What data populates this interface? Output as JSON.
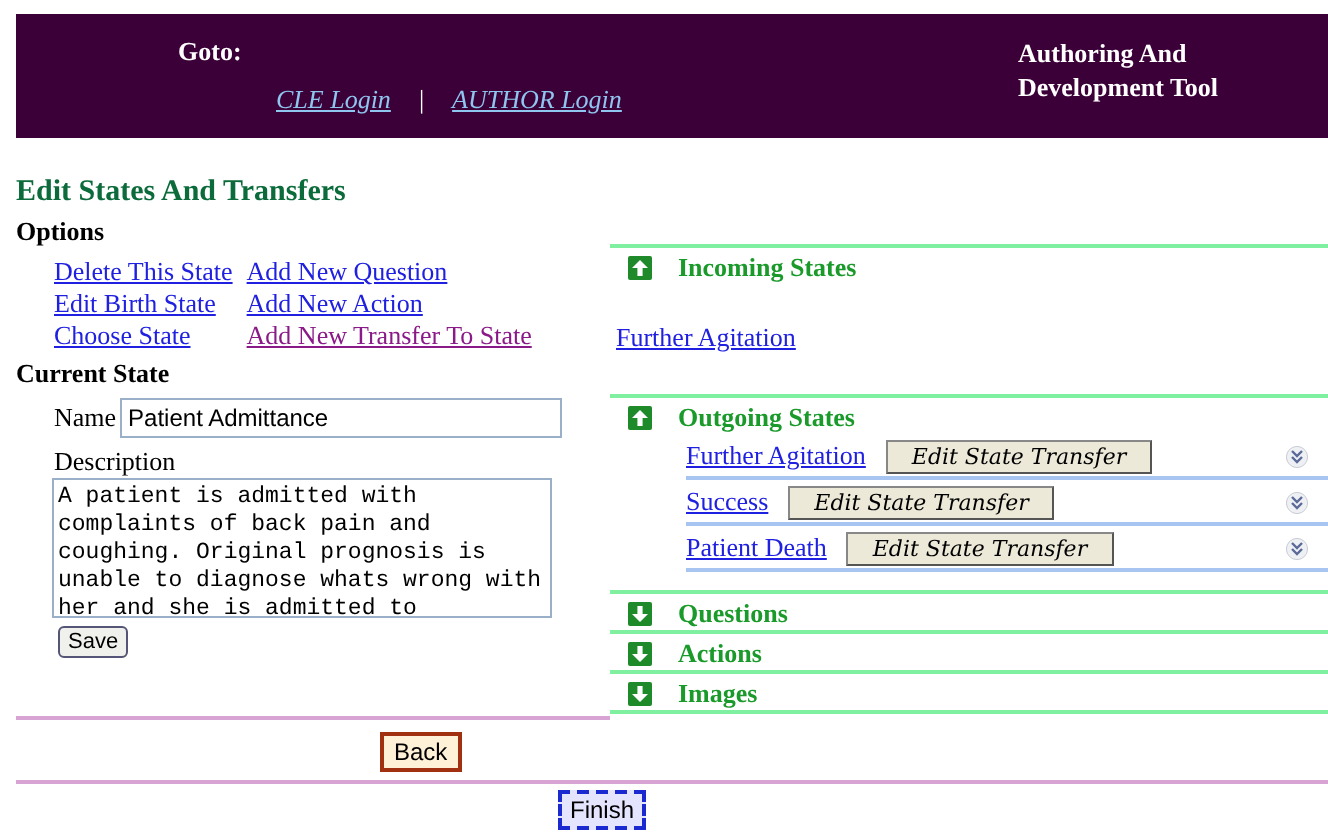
{
  "header": {
    "goto_label": "Goto:",
    "links": [
      "CLE Login",
      "AUTHOR Login"
    ],
    "separator": "|",
    "tool_title": "Authoring And Development Tool"
  },
  "page_title": "Edit States And Transfers",
  "options": {
    "heading": "Options",
    "links": [
      {
        "label": "Delete This State",
        "visited": false
      },
      {
        "label": "Add New Question",
        "visited": false
      },
      {
        "label": "Edit Birth State",
        "visited": false
      },
      {
        "label": "Add New Action",
        "visited": false
      },
      {
        "label": "Choose State",
        "visited": false
      },
      {
        "label": "Add New Transfer To State",
        "visited": true
      }
    ]
  },
  "current_state": {
    "heading": "Current State",
    "name_label": "Name",
    "name_value": "Patient Admittance",
    "description_label": "Description",
    "description_value": "A patient is admitted with complaints of back pain and coughing. Original prognosis is unable to diagnose whats wrong with her and she is admitted to",
    "save_button": "Save"
  },
  "sections": [
    {
      "title": "Incoming States",
      "expanded": true,
      "links": [
        "Further Agitation"
      ]
    },
    {
      "title": "Outgoing States",
      "expanded": true,
      "transfers": [
        {
          "state": "Further Agitation",
          "button": "Edit State Transfer"
        },
        {
          "state": "Success",
          "button": "Edit State Transfer"
        },
        {
          "state": "Patient Death",
          "button": "Edit State Transfer"
        }
      ]
    },
    {
      "title": "Questions",
      "expanded": false
    },
    {
      "title": "Actions",
      "expanded": false
    },
    {
      "title": "Images",
      "expanded": false
    }
  ],
  "back_button": "Back",
  "finish_button": "Finish"
}
